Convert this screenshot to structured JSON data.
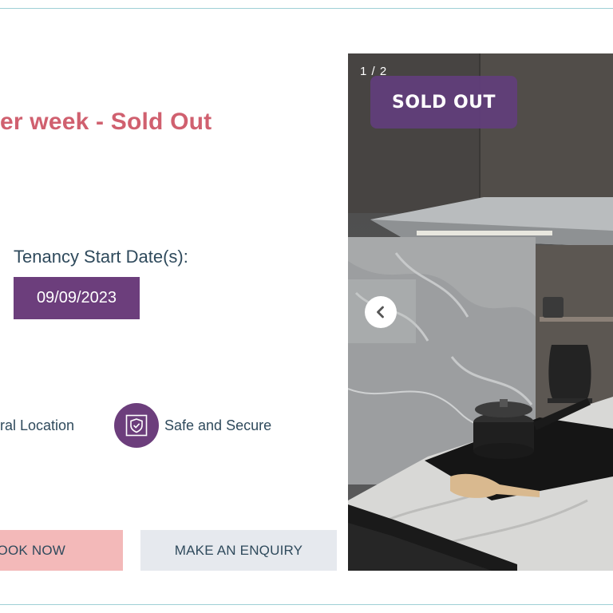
{
  "listing": {
    "price_heading": "er week - Sold Out",
    "tenancy_label": "Tenancy Start Date(s):",
    "start_date": "09/09/2023"
  },
  "features": {
    "central_location": "ral Location",
    "safe_secure": "Safe and Secure"
  },
  "buttons": {
    "book_now": "OOK NOW",
    "make_enquiry": "MAKE AN ENQUIRY"
  },
  "gallery": {
    "counter": "1 / 2",
    "sold_tag": "SOLD OUT"
  },
  "colors": {
    "heading": "#d0606f",
    "accent_purple": "#6c3e7c",
    "book_button": "#f3b9b9",
    "enquiry_button": "#e6e9ee",
    "frame_line": "#9fcfd6"
  },
  "icons": {
    "safe": "shield-check-icon",
    "gallery_prev": "chevron-left-icon"
  }
}
